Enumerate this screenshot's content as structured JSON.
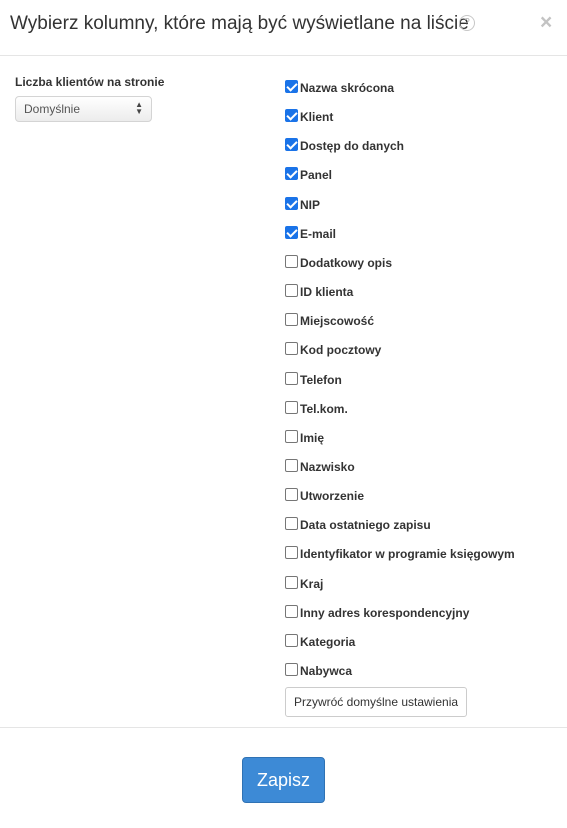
{
  "header": {
    "title": "Wybierz kolumny, które mają być wyświetlane na liście",
    "help_glyph": "?",
    "close_glyph": "×"
  },
  "per_page": {
    "label": "Liczba klientów na stronie",
    "selected": "Domyślnie"
  },
  "columns": [
    {
      "label": "Nazwa skrócona",
      "checked": true
    },
    {
      "label": "Klient",
      "checked": true
    },
    {
      "label": "Dostęp do danych",
      "checked": true
    },
    {
      "label": "Panel",
      "checked": true
    },
    {
      "label": "NIP",
      "checked": true
    },
    {
      "label": "E-mail",
      "checked": true
    },
    {
      "label": "Dodatkowy opis",
      "checked": false
    },
    {
      "label": "ID klienta",
      "checked": false
    },
    {
      "label": "Miejscowość",
      "checked": false
    },
    {
      "label": "Kod pocztowy",
      "checked": false
    },
    {
      "label": "Telefon",
      "checked": false
    },
    {
      "label": "Tel.kom.",
      "checked": false
    },
    {
      "label": "Imię",
      "checked": false
    },
    {
      "label": "Nazwisko",
      "checked": false
    },
    {
      "label": "Utworzenie",
      "checked": false
    },
    {
      "label": "Data ostatniego zapisu",
      "checked": false
    },
    {
      "label": "Identyfikator w programie księgowym",
      "checked": false
    },
    {
      "label": "Kraj",
      "checked": false
    },
    {
      "label": "Inny adres korespondencyjny",
      "checked": false
    },
    {
      "label": "Kategoria",
      "checked": false
    },
    {
      "label": "Nabywca",
      "checked": false
    }
  ],
  "buttons": {
    "restore_label": "Przywróć domyślne ustawienia",
    "save_label": "Zapisz"
  },
  "colors": {
    "accent": "#3d8ad6",
    "checkbox_checked": "#1a73e8"
  }
}
